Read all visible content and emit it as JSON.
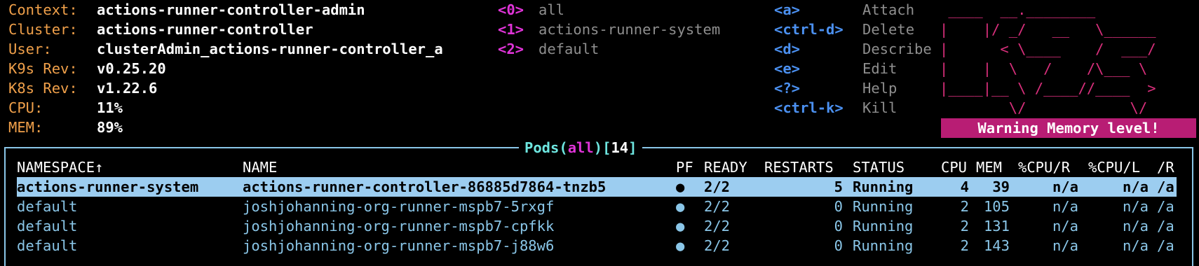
{
  "info": {
    "rows": [
      {
        "key": "Context:",
        "value": "actions-runner-controller-admin"
      },
      {
        "key": "Cluster:",
        "value": "actions-runner-controller"
      },
      {
        "key": "User:",
        "value": "clusterAdmin_actions-runner-controller_a"
      },
      {
        "key": "K9s Rev:",
        "value": "v0.25.20"
      },
      {
        "key": "K8s Rev:",
        "value": "v1.22.6"
      },
      {
        "key": "CPU:",
        "value": "11%"
      },
      {
        "key": "MEM:",
        "value": "89%"
      }
    ]
  },
  "namespaces": [
    {
      "key": "<0>",
      "label": "all"
    },
    {
      "key": "<1>",
      "label": "actions-runner-system"
    },
    {
      "key": "<2>",
      "label": "default"
    }
  ],
  "hotkeys": [
    {
      "key": "<a>",
      "label": "Attach"
    },
    {
      "key": "<ctrl-d>",
      "label": "Delete"
    },
    {
      "key": "<d>",
      "label": "Describe"
    },
    {
      "key": "<e>",
      "label": "Edit"
    },
    {
      "key": "<?>",
      "label": "Help"
    },
    {
      "key": "<ctrl-k>",
      "label": "Kill"
    }
  ],
  "logo": " ____  __.________\n|    |/ _/   __   \\______\n|      < \\____    /  ___/\n|    |  \\   /    /\\___ \\\n|____|__ \\ /____//____  >\n        \\/            \\/",
  "warning": "Warning Memory level!",
  "table": {
    "title_resource": "Pods",
    "title_namespace": "all",
    "title_count": "14",
    "headers": {
      "namespace": "NAMESPACE↑",
      "name": "NAME",
      "pf": "PF",
      "ready": "READY",
      "restarts": "RESTARTS",
      "status": "STATUS",
      "cpu": "CPU",
      "mem": "MEM",
      "cpu_r": "%CPU/R",
      "cpu_l": "%CPU/L",
      "r": "/R"
    },
    "rows": [
      {
        "namespace": "actions-runner-system",
        "name": "actions-runner-controller-86885d7864-tnzb5",
        "pf": "●",
        "ready": "2/2",
        "restarts": "5",
        "status": "Running",
        "cpu": "4",
        "mem": "39",
        "cpu_r": "n/a",
        "cpu_l": "n/a",
        "r": "/a"
      },
      {
        "namespace": "default",
        "name": "joshjohanning-org-runner-mspb7-5rxgf",
        "pf": "●",
        "ready": "2/2",
        "restarts": "0",
        "status": "Running",
        "cpu": "2",
        "mem": "105",
        "cpu_r": "n/a",
        "cpu_l": "n/a",
        "r": "/a"
      },
      {
        "namespace": "default",
        "name": "joshjohanning-org-runner-mspb7-cpfkk",
        "pf": "●",
        "ready": "2/2",
        "restarts": "0",
        "status": "Running",
        "cpu": "2",
        "mem": "131",
        "cpu_r": "n/a",
        "cpu_l": "n/a",
        "r": "/a"
      },
      {
        "namespace": "default",
        "name": "joshjohanning-org-runner-mspb7-j88w6",
        "pf": "●",
        "ready": "2/2",
        "restarts": "0",
        "status": "Running",
        "cpu": "2",
        "mem": "143",
        "cpu_r": "n/a",
        "cpu_l": "n/a",
        "r": "/a"
      }
    ]
  }
}
